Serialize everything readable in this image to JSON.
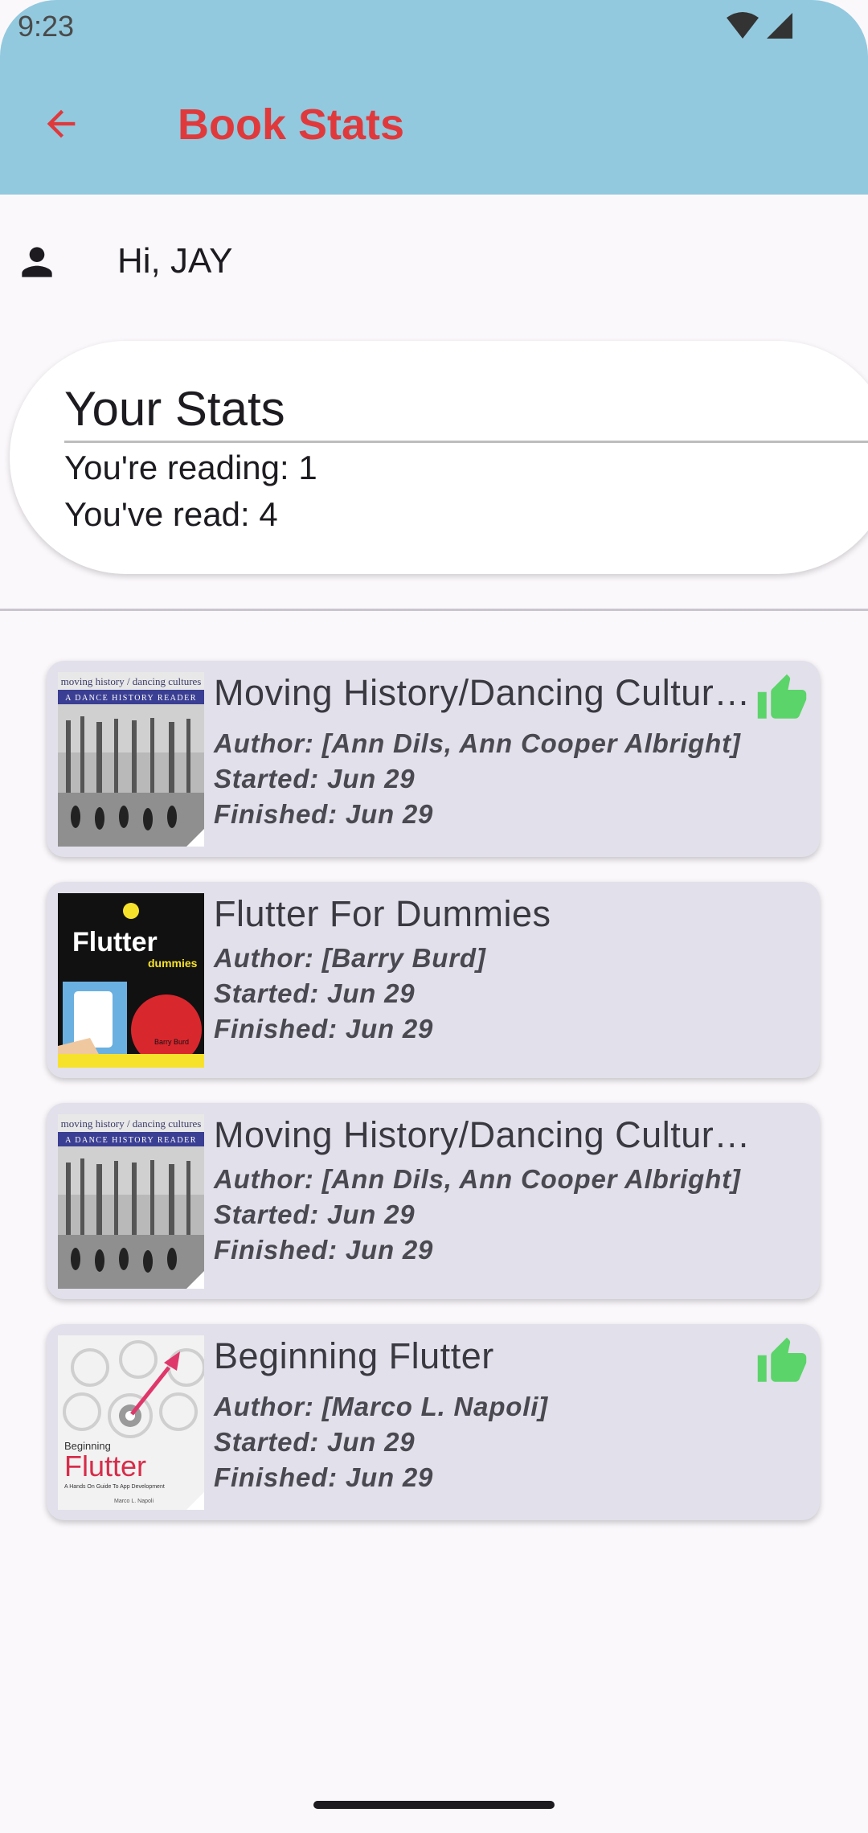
{
  "status_bar": {
    "time": "9:23"
  },
  "app_bar": {
    "title": "Book Stats",
    "back_icon": "arrow-back-icon"
  },
  "greeting": {
    "text": "Hi, JAY",
    "icon": "person-icon"
  },
  "stats": {
    "title": "Your Stats",
    "reading": "You're reading: 1",
    "read": "You've read: 4"
  },
  "books": [
    {
      "title": "Moving History/Dancing Cultures",
      "author": "Author: [Ann Dils, Ann Cooper Albright]",
      "started": "Started: Jun 29",
      "finished": "Finished: Jun 29",
      "liked": true,
      "cover": {
        "top_line": "moving history / dancing cultures",
        "band": "A DANCE HISTORY READER"
      }
    },
    {
      "title": "Flutter For Dummies",
      "author": "Author: [Barry Burd]",
      "started": "Started: Jun 29",
      "finished": "Finished: Jun 29",
      "liked": false,
      "cover": {
        "brand": "Flutter",
        "sub": "dummies",
        "author": "Barry Burd"
      }
    },
    {
      "title": "Moving History/Dancing Cultures",
      "author": "Author: [Ann Dils, Ann Cooper Albright]",
      "started": "Started: Jun 29",
      "finished": "Finished: Jun 29",
      "liked": false,
      "cover": {
        "top_line": "moving history / dancing cultures",
        "band": "A DANCE HISTORY READER"
      }
    },
    {
      "title": "Beginning Flutter",
      "author": "Author: [Marco L. Napoli]",
      "started": "Started: Jun 29",
      "finished": "Finished: Jun 29",
      "liked": true,
      "cover": {
        "top": "Beginning",
        "brand": "Flutter",
        "sub": "A Hands On Guide To App Development",
        "author": "Marco L. Napoli"
      }
    }
  ],
  "colors": {
    "app_bar": "#92c9de",
    "title_red": "#e0393c",
    "card": "#e2e0ea",
    "thumb_green": "#5bd46a"
  }
}
